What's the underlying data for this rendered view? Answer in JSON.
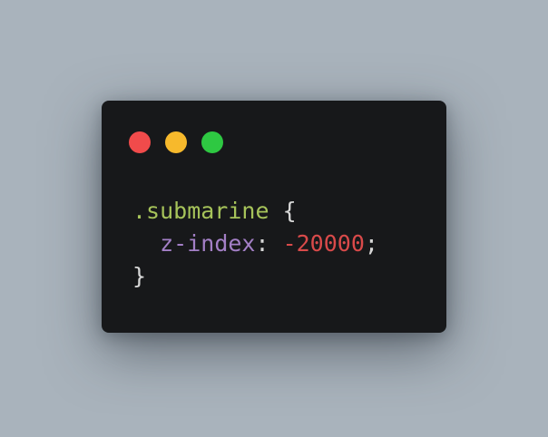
{
  "background_color": "#a9b3bc",
  "window": {
    "background_color": "#17181a",
    "traffic_lights": [
      {
        "name": "close",
        "color": "#f14b4b"
      },
      {
        "name": "minimize",
        "color": "#f7b92c"
      },
      {
        "name": "maximize",
        "color": "#2ec842"
      }
    ]
  },
  "code": {
    "colors": {
      "selector": "#a6c35a",
      "property": "#a37fc6",
      "value": "#d94a4a",
      "punctuation": "#d8d8d8"
    },
    "line1": {
      "selector": ".submarine",
      "open_brace": " {"
    },
    "line2": {
      "indent": "  ",
      "property": "z-index",
      "colon": ": ",
      "value": "-20000",
      "semicolon": ";"
    },
    "line3": {
      "close_brace": "}"
    }
  }
}
